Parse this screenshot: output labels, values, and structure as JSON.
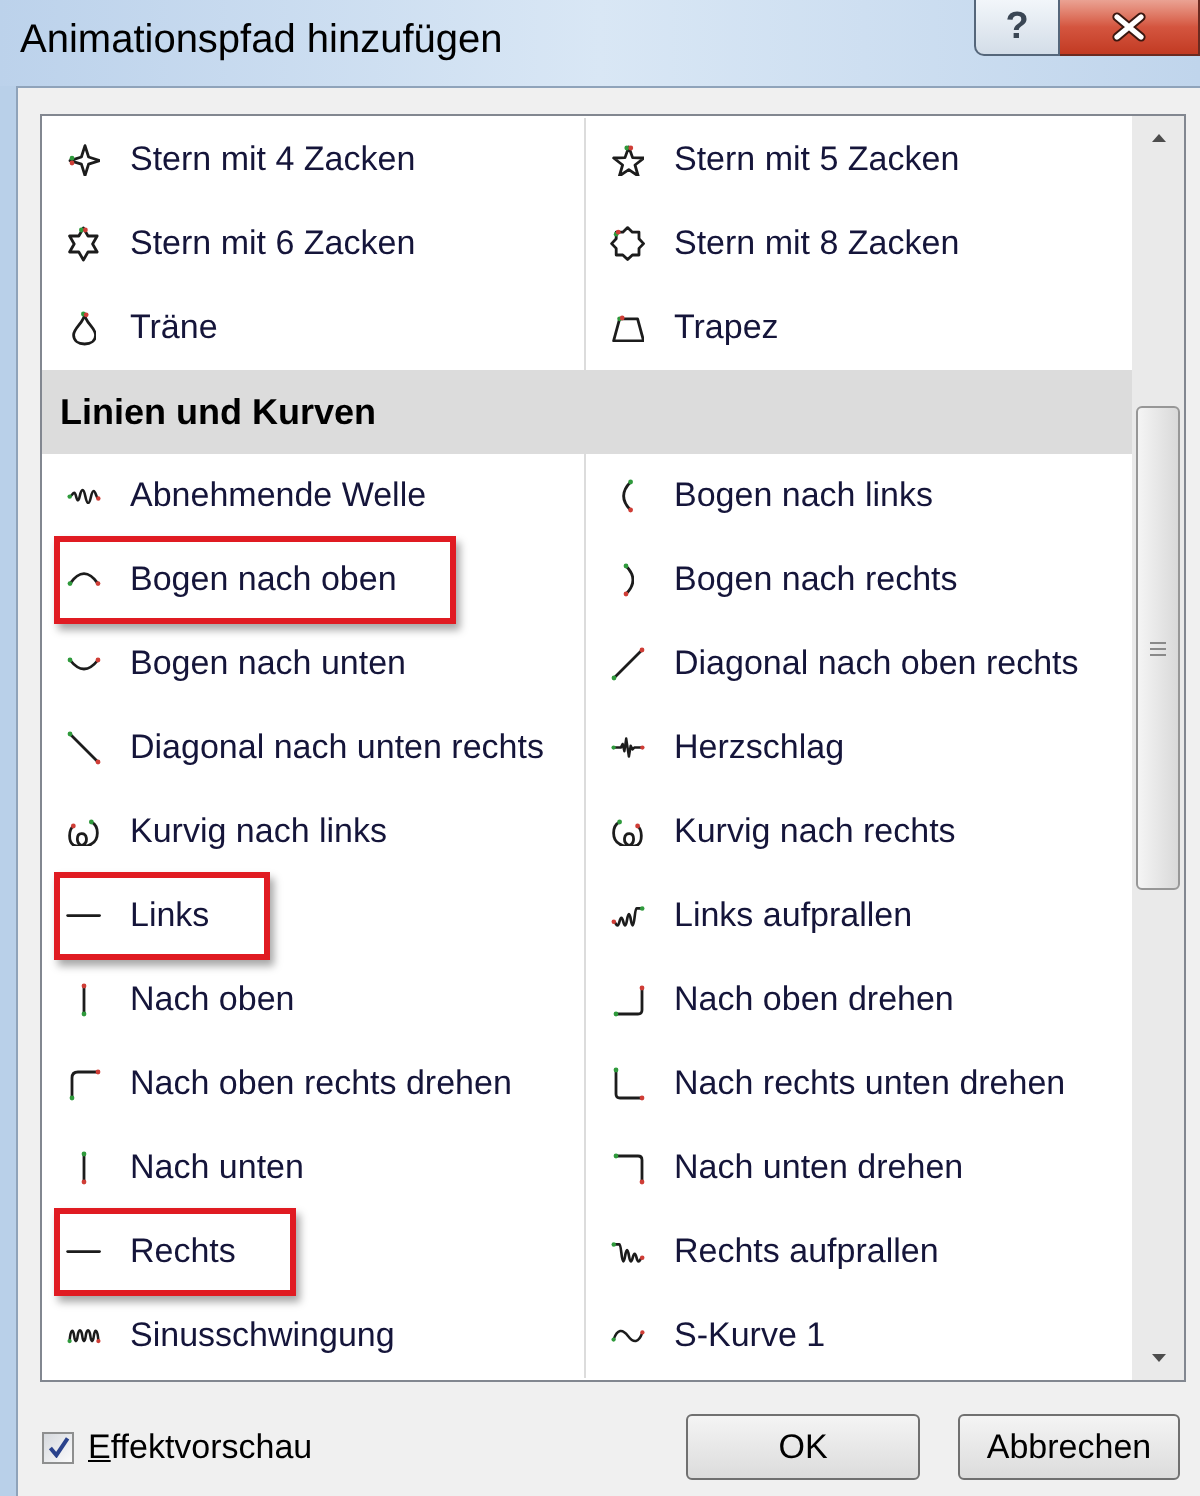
{
  "window": {
    "title": "Animationspfad hinzufügen",
    "help_button": "?"
  },
  "list": {
    "sections": [
      {
        "items": [
          {
            "label": "Stern mit 4 Zacken",
            "kind": "star4",
            "selected": false,
            "highlighted": false
          },
          {
            "label": "Stern mit 5 Zacken",
            "kind": "star5",
            "selected": false,
            "highlighted": false
          },
          {
            "label": "Stern mit 6 Zacken",
            "kind": "star6",
            "selected": false,
            "highlighted": false
          },
          {
            "label": "Stern mit 8 Zacken",
            "kind": "star8",
            "selected": false,
            "highlighted": false
          },
          {
            "label": "Träne",
            "kind": "teardrop",
            "selected": false,
            "highlighted": false
          },
          {
            "label": "Trapez",
            "kind": "trapezoid",
            "selected": false,
            "highlighted": false
          }
        ]
      },
      {
        "header": "Linien und Kurven",
        "items": [
          {
            "label": "Abnehmende Welle",
            "kind": "decaywave",
            "selected": false,
            "highlighted": false
          },
          {
            "label": "Bogen nach links",
            "kind": "arcleft",
            "selected": false,
            "highlighted": false
          },
          {
            "label": "Bogen nach oben",
            "kind": "arcup",
            "selected": false,
            "highlighted": true
          },
          {
            "label": "Bogen nach rechts",
            "kind": "arcright",
            "selected": false,
            "highlighted": false
          },
          {
            "label": "Bogen nach unten",
            "kind": "arcdown",
            "selected": false,
            "highlighted": false
          },
          {
            "label": "Diagonal nach oben rechts",
            "kind": "diagup",
            "selected": false,
            "highlighted": false
          },
          {
            "label": "Diagonal nach unten rechts",
            "kind": "diagdown",
            "selected": false,
            "highlighted": false
          },
          {
            "label": "Herzschlag",
            "kind": "heartbeat",
            "selected": false,
            "highlighted": false
          },
          {
            "label": "Kurvig nach links",
            "kind": "loopleft",
            "selected": false,
            "highlighted": false
          },
          {
            "label": "Kurvig nach rechts",
            "kind": "loopright",
            "selected": false,
            "highlighted": false
          },
          {
            "label": "Links",
            "kind": "lineleft",
            "selected": false,
            "highlighted": true
          },
          {
            "label": "Links aufprallen",
            "kind": "bounceleft",
            "selected": false,
            "highlighted": false
          },
          {
            "label": "Nach oben",
            "kind": "lineup",
            "selected": false,
            "highlighted": false
          },
          {
            "label": "Nach oben drehen",
            "kind": "turnup",
            "selected": false,
            "highlighted": false
          },
          {
            "label": "Nach oben rechts drehen",
            "kind": "turnupright",
            "selected": false,
            "highlighted": false
          },
          {
            "label": "Nach rechts unten drehen",
            "kind": "turnrightdown",
            "selected": false,
            "highlighted": false
          },
          {
            "label": "Nach unten",
            "kind": "linedown",
            "selected": false,
            "highlighted": false
          },
          {
            "label": "Nach unten drehen",
            "kind": "turndown",
            "selected": false,
            "highlighted": false
          },
          {
            "label": "Rechts",
            "kind": "lineright",
            "selected": false,
            "highlighted": true
          },
          {
            "label": "Rechts aufprallen",
            "kind": "bounceright",
            "selected": false,
            "highlighted": false
          },
          {
            "label": "Sinusschwingung",
            "kind": "sine",
            "selected": false,
            "highlighted": false
          },
          {
            "label": "S-Kurve 1",
            "kind": "scurve",
            "selected": false,
            "highlighted": false
          }
        ]
      }
    ]
  },
  "preview": {
    "label": "Effektvorschau",
    "checked": true,
    "mnemonic_underlined": true
  },
  "buttons": [
    {
      "label": "OK"
    },
    {
      "label": "Abbrechen"
    }
  ]
}
